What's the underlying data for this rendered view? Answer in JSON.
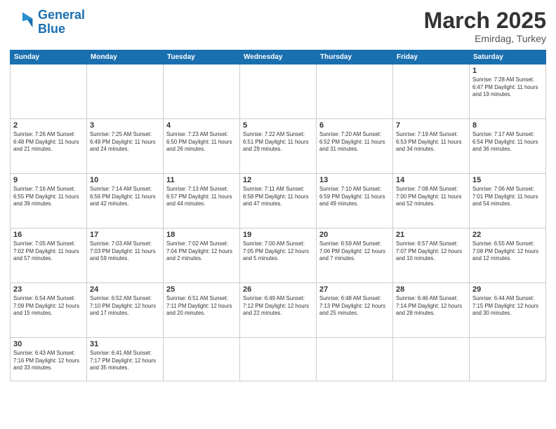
{
  "header": {
    "logo_general": "General",
    "logo_blue": "Blue",
    "month": "March 2025",
    "location": "Emirdag, Turkey"
  },
  "days_of_week": [
    "Sunday",
    "Monday",
    "Tuesday",
    "Wednesday",
    "Thursday",
    "Friday",
    "Saturday"
  ],
  "weeks": [
    [
      {
        "day": "",
        "info": ""
      },
      {
        "day": "",
        "info": ""
      },
      {
        "day": "",
        "info": ""
      },
      {
        "day": "",
        "info": ""
      },
      {
        "day": "",
        "info": ""
      },
      {
        "day": "",
        "info": ""
      },
      {
        "day": "1",
        "info": "Sunrise: 7:28 AM\nSunset: 6:47 PM\nDaylight: 11 hours\nand 19 minutes."
      }
    ],
    [
      {
        "day": "2",
        "info": "Sunrise: 7:26 AM\nSunset: 6:48 PM\nDaylight: 11 hours\nand 21 minutes."
      },
      {
        "day": "3",
        "info": "Sunrise: 7:25 AM\nSunset: 6:49 PM\nDaylight: 11 hours\nand 24 minutes."
      },
      {
        "day": "4",
        "info": "Sunrise: 7:23 AM\nSunset: 6:50 PM\nDaylight: 11 hours\nand 26 minutes."
      },
      {
        "day": "5",
        "info": "Sunrise: 7:22 AM\nSunset: 6:51 PM\nDaylight: 11 hours\nand 29 minutes."
      },
      {
        "day": "6",
        "info": "Sunrise: 7:20 AM\nSunset: 6:52 PM\nDaylight: 11 hours\nand 31 minutes."
      },
      {
        "day": "7",
        "info": "Sunrise: 7:19 AM\nSunset: 6:53 PM\nDaylight: 11 hours\nand 34 minutes."
      },
      {
        "day": "8",
        "info": "Sunrise: 7:17 AM\nSunset: 6:54 PM\nDaylight: 11 hours\nand 36 minutes."
      }
    ],
    [
      {
        "day": "9",
        "info": "Sunrise: 7:16 AM\nSunset: 6:55 PM\nDaylight: 11 hours\nand 39 minutes."
      },
      {
        "day": "10",
        "info": "Sunrise: 7:14 AM\nSunset: 6:56 PM\nDaylight: 11 hours\nand 42 minutes."
      },
      {
        "day": "11",
        "info": "Sunrise: 7:13 AM\nSunset: 6:57 PM\nDaylight: 11 hours\nand 44 minutes."
      },
      {
        "day": "12",
        "info": "Sunrise: 7:11 AM\nSunset: 6:58 PM\nDaylight: 11 hours\nand 47 minutes."
      },
      {
        "day": "13",
        "info": "Sunrise: 7:10 AM\nSunset: 6:59 PM\nDaylight: 11 hours\nand 49 minutes."
      },
      {
        "day": "14",
        "info": "Sunrise: 7:08 AM\nSunset: 7:00 PM\nDaylight: 11 hours\nand 52 minutes."
      },
      {
        "day": "15",
        "info": "Sunrise: 7:06 AM\nSunset: 7:01 PM\nDaylight: 11 hours\nand 54 minutes."
      }
    ],
    [
      {
        "day": "16",
        "info": "Sunrise: 7:05 AM\nSunset: 7:02 PM\nDaylight: 11 hours\nand 57 minutes."
      },
      {
        "day": "17",
        "info": "Sunrise: 7:03 AM\nSunset: 7:03 PM\nDaylight: 11 hours\nand 59 minutes."
      },
      {
        "day": "18",
        "info": "Sunrise: 7:02 AM\nSunset: 7:04 PM\nDaylight: 12 hours\nand 2 minutes."
      },
      {
        "day": "19",
        "info": "Sunrise: 7:00 AM\nSunset: 7:05 PM\nDaylight: 12 hours\nand 5 minutes."
      },
      {
        "day": "20",
        "info": "Sunrise: 6:59 AM\nSunset: 7:06 PM\nDaylight: 12 hours\nand 7 minutes."
      },
      {
        "day": "21",
        "info": "Sunrise: 6:57 AM\nSunset: 7:07 PM\nDaylight: 12 hours\nand 10 minutes."
      },
      {
        "day": "22",
        "info": "Sunrise: 6:55 AM\nSunset: 7:08 PM\nDaylight: 12 hours\nand 12 minutes."
      }
    ],
    [
      {
        "day": "23",
        "info": "Sunrise: 6:54 AM\nSunset: 7:09 PM\nDaylight: 12 hours\nand 15 minutes."
      },
      {
        "day": "24",
        "info": "Sunrise: 6:52 AM\nSunset: 7:10 PM\nDaylight: 12 hours\nand 17 minutes."
      },
      {
        "day": "25",
        "info": "Sunrise: 6:51 AM\nSunset: 7:11 PM\nDaylight: 12 hours\nand 20 minutes."
      },
      {
        "day": "26",
        "info": "Sunrise: 6:49 AM\nSunset: 7:12 PM\nDaylight: 12 hours\nand 22 minutes."
      },
      {
        "day": "27",
        "info": "Sunrise: 6:48 AM\nSunset: 7:13 PM\nDaylight: 12 hours\nand 25 minutes."
      },
      {
        "day": "28",
        "info": "Sunrise: 6:46 AM\nSunset: 7:14 PM\nDaylight: 12 hours\nand 28 minutes."
      },
      {
        "day": "29",
        "info": "Sunrise: 6:44 AM\nSunset: 7:15 PM\nDaylight: 12 hours\nand 30 minutes."
      }
    ],
    [
      {
        "day": "30",
        "info": "Sunrise: 6:43 AM\nSunset: 7:16 PM\nDaylight: 12 hours\nand 33 minutes."
      },
      {
        "day": "31",
        "info": "Sunrise: 6:41 AM\nSunset: 7:17 PM\nDaylight: 12 hours\nand 35 minutes."
      },
      {
        "day": "",
        "info": ""
      },
      {
        "day": "",
        "info": ""
      },
      {
        "day": "",
        "info": ""
      },
      {
        "day": "",
        "info": ""
      },
      {
        "day": "",
        "info": ""
      }
    ]
  ]
}
